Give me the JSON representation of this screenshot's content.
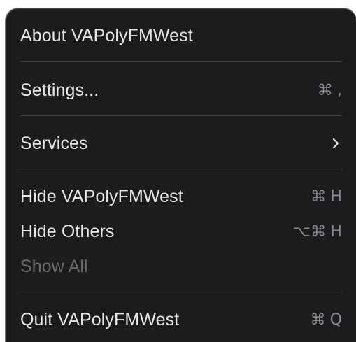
{
  "menu": {
    "about": {
      "label": "About VAPolyFMWest"
    },
    "settings": {
      "label": "Settings...",
      "shortcut_mod": "⌘",
      "shortcut_key": ","
    },
    "services": {
      "label": "Services",
      "submenu_icon": "chevron-right-icon"
    },
    "hide_app": {
      "label": "Hide VAPolyFMWest",
      "shortcut_mod": "⌘",
      "shortcut_key": "H"
    },
    "hide_others": {
      "label": "Hide Others",
      "shortcut_mod": "⌥⌘",
      "shortcut_key": "H"
    },
    "show_all": {
      "label": "Show All"
    },
    "quit": {
      "label": "Quit VAPolyFMWest",
      "shortcut_mod": "⌘",
      "shortcut_key": "Q"
    }
  },
  "colors": {
    "menu_background": "#1c1c1e",
    "text": "#e6e6e6",
    "shortcut_text": "#8a8a8e",
    "disabled_text": "#6a6a6d",
    "separator": "#3c3c3f"
  }
}
